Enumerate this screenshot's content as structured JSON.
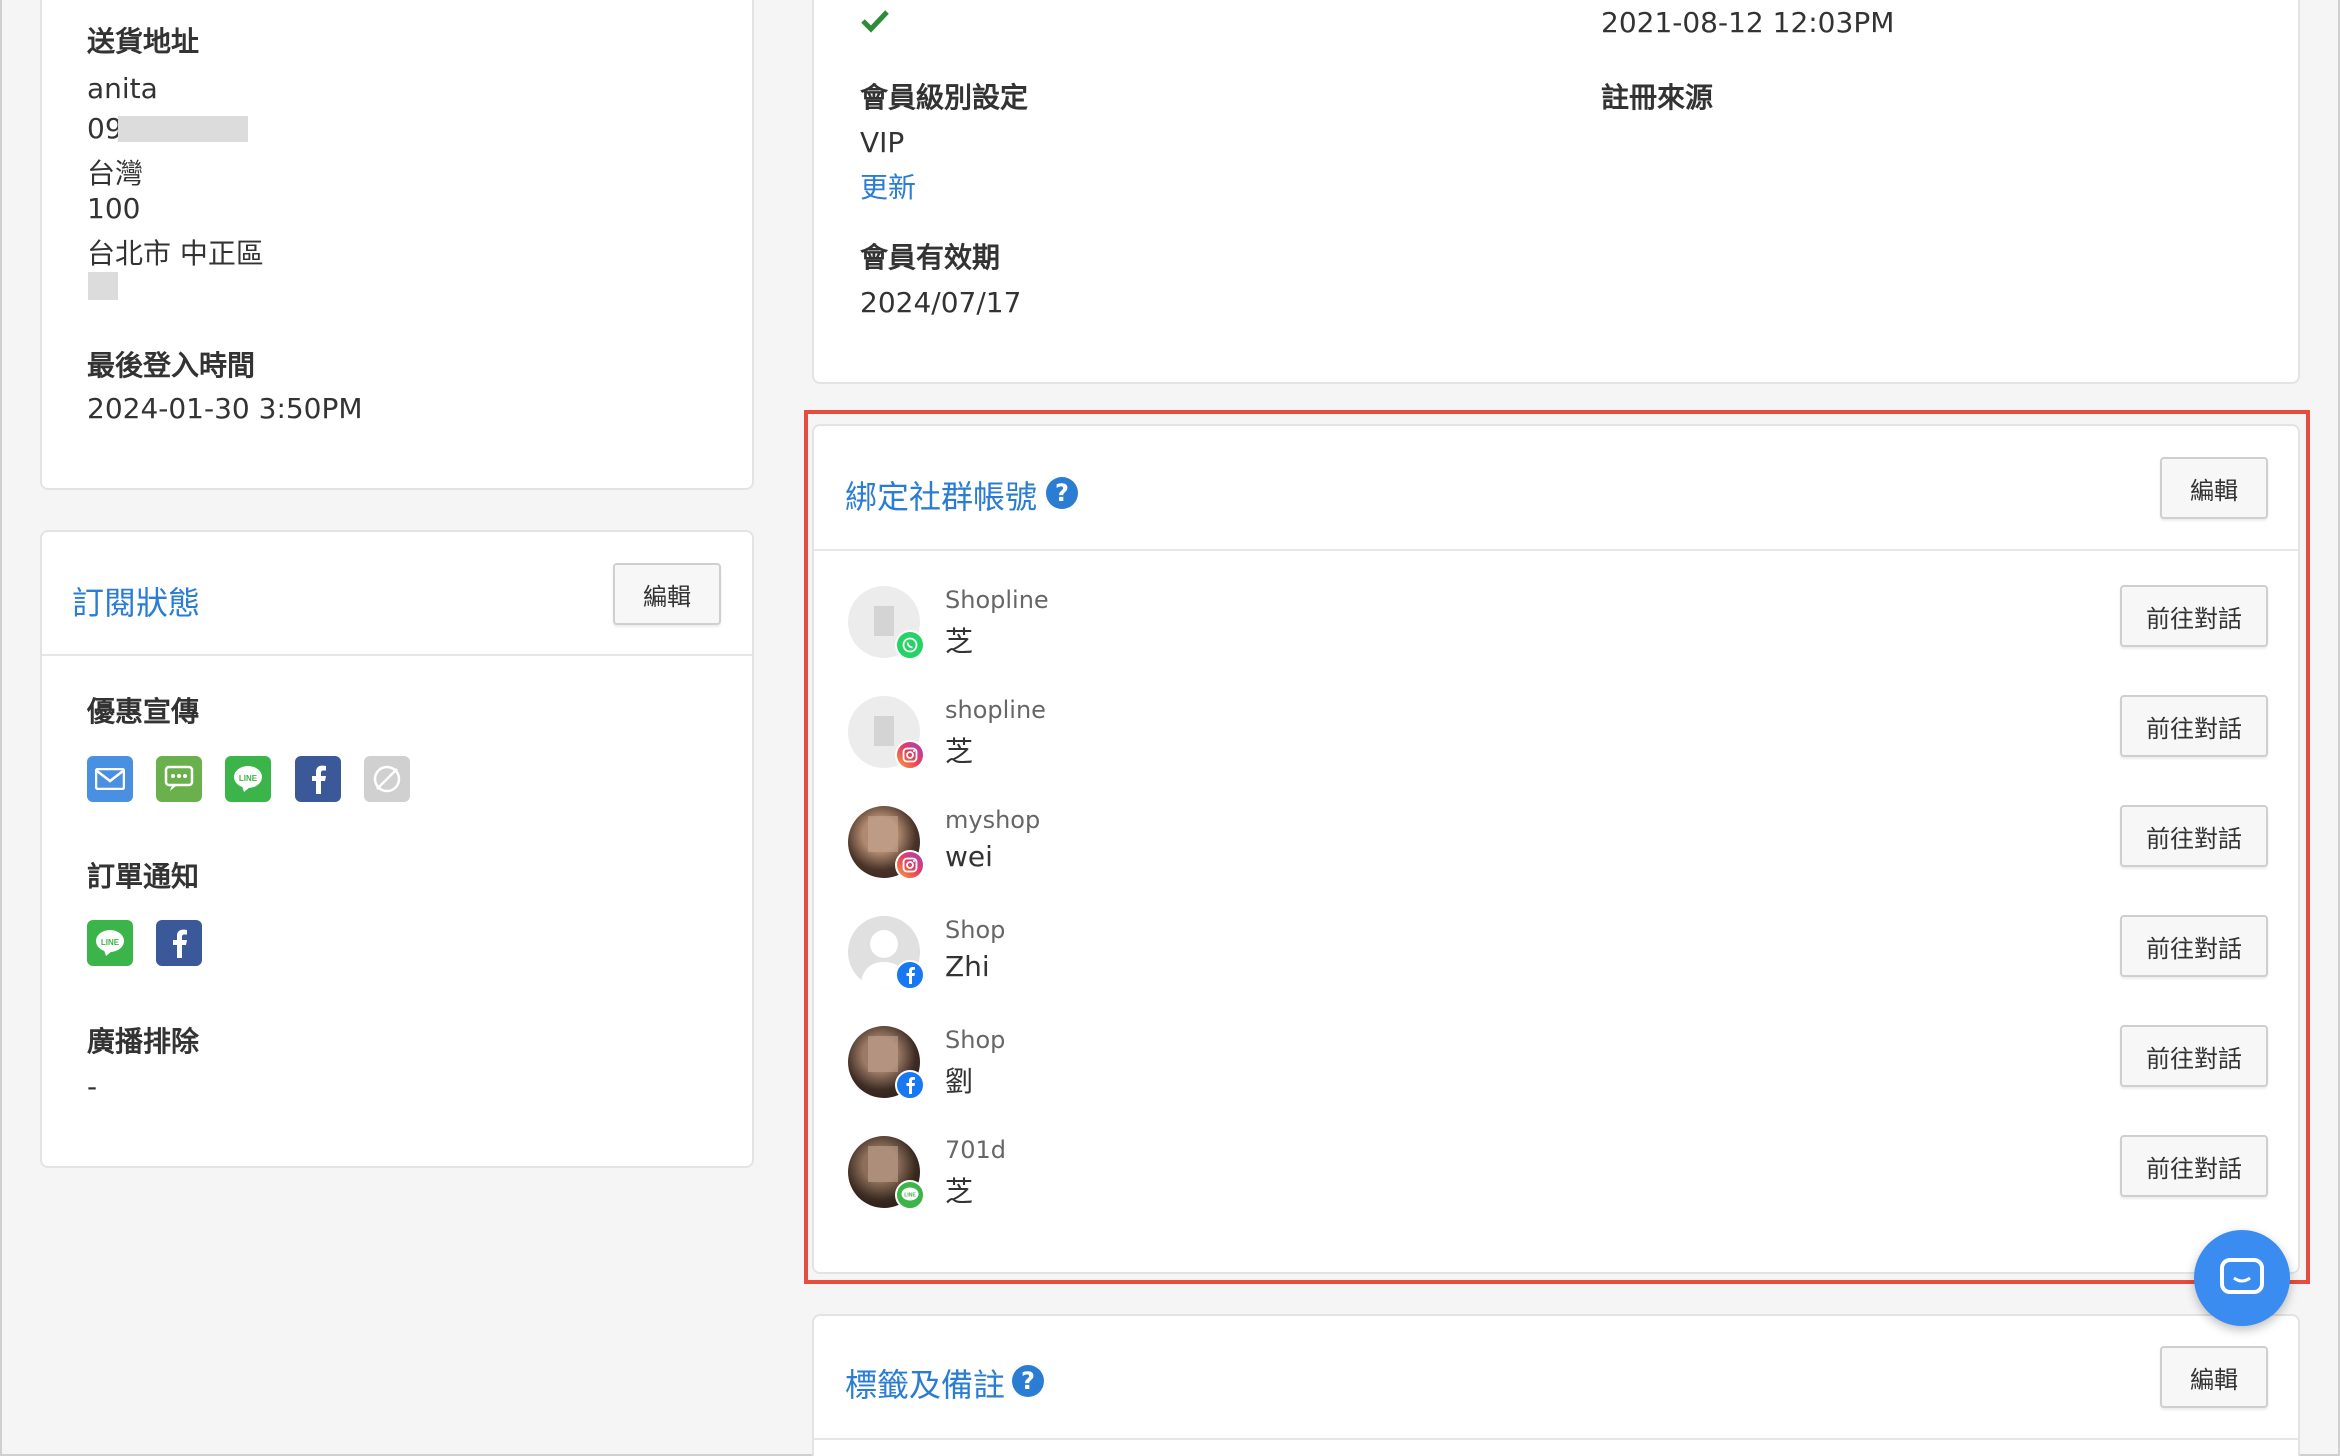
{
  "shipping": {
    "label": "送貨地址",
    "name": "anita",
    "phone_prefix": "09",
    "country": "台灣",
    "zip": "100",
    "city": "台北市 中正區"
  },
  "last_login": {
    "label": "最後登入時間",
    "value": "2024-01-30 3:50PM"
  },
  "subscription": {
    "title": "訂閱狀態",
    "edit_label": "編輯",
    "promo_label": "優惠宣傳",
    "promo_icons": [
      "email-icon",
      "sms-icon",
      "line-icon",
      "facebook-icon",
      "disabled-icon"
    ],
    "order_label": "訂單通知",
    "order_icons": [
      "line-icon",
      "facebook-icon"
    ],
    "broadcast_label": "廣播排除",
    "broadcast_value": "-"
  },
  "member": {
    "register_date": "2021-08-12 12:03PM",
    "tier_label": "會員級別設定",
    "tier_value": "VIP",
    "tier_update": "更新",
    "register_source_label": "註冊來源",
    "expiry_label": "會員有效期",
    "expiry_value": "2024/07/17"
  },
  "social": {
    "title": "綁定社群帳號",
    "help": "?",
    "edit_label": "編輯",
    "chat_label": "前往對話",
    "accounts": [
      {
        "source": "Shopline",
        "name": "芝",
        "platform": "whatsapp"
      },
      {
        "source": "shopline",
        "name": "芝",
        "platform": "instagram"
      },
      {
        "source": "myshop",
        "name": "wei",
        "platform": "instagram"
      },
      {
        "source": "Shop",
        "name": "Zhi",
        "platform": "facebook"
      },
      {
        "source": "Shop",
        "name": "劉",
        "platform": "facebook"
      },
      {
        "source": "701d",
        "name": "芝",
        "platform": "line"
      }
    ]
  },
  "tags": {
    "title": "標籤及備註",
    "help": "?",
    "edit_label": "編輯"
  },
  "colors": {
    "accent": "#2a7dd3",
    "highlight": "#e74c3c",
    "check": "#2e8b3a"
  }
}
